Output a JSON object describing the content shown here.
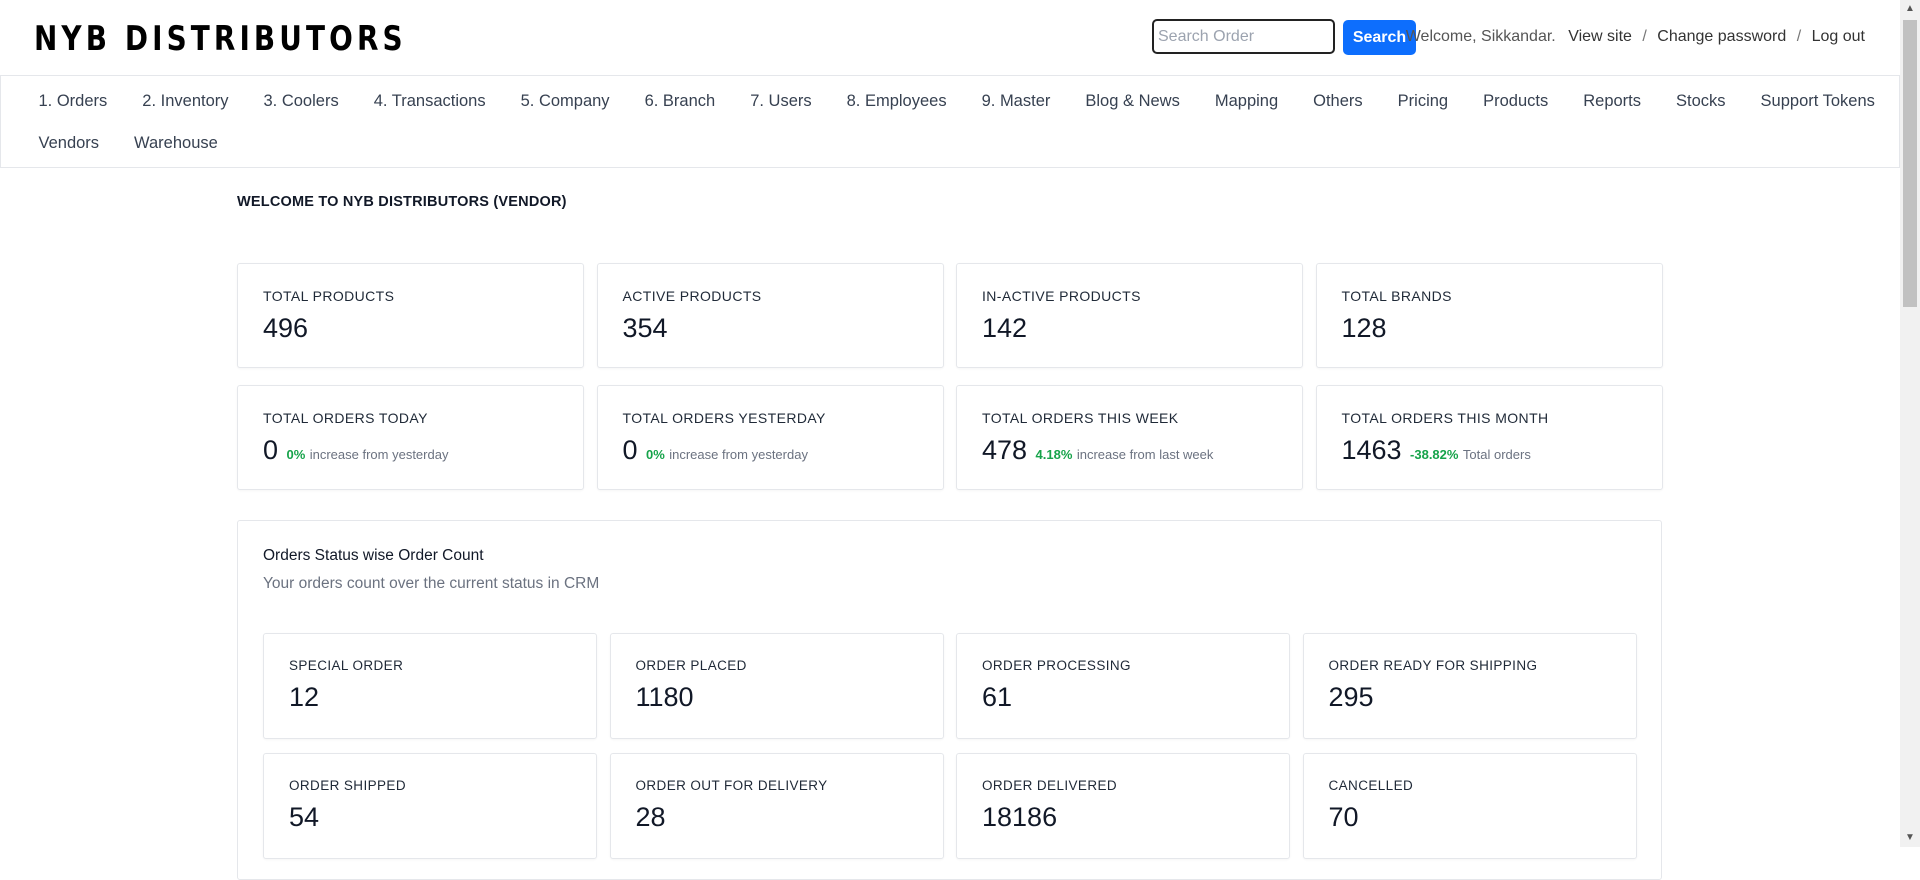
{
  "header": {
    "logo": "NYB DISTRIBUTORS",
    "search_placeholder": "Search Order",
    "search_button": "Search",
    "welcome_text": "Welcome, Sikkandar.",
    "view_site": "View site",
    "change_password": "Change password",
    "log_out": "Log out",
    "separator": "/"
  },
  "nav": {
    "items": [
      {
        "label": "1. Orders"
      },
      {
        "label": "2. Inventory"
      },
      {
        "label": "3. Coolers"
      },
      {
        "label": "4. Transactions"
      },
      {
        "label": "5. Company"
      },
      {
        "label": "6. Branch"
      },
      {
        "label": "7. Users"
      },
      {
        "label": "8. Employees"
      },
      {
        "label": "9. Master"
      },
      {
        "label": "Blog & News"
      },
      {
        "label": "Mapping"
      },
      {
        "label": "Others"
      },
      {
        "label": "Pricing"
      },
      {
        "label": "Products"
      },
      {
        "label": "Reports"
      },
      {
        "label": "Stocks"
      },
      {
        "label": "Support Tokens"
      },
      {
        "label": "Vendors"
      },
      {
        "label": "Warehouse"
      }
    ]
  },
  "main": {
    "welcome_title": "WELCOME TO NYB DISTRIBUTORS (VENDOR)",
    "product_stats": [
      {
        "label": "TOTAL PRODUCTS",
        "value": "496"
      },
      {
        "label": "ACTIVE PRODUCTS",
        "value": "354"
      },
      {
        "label": "IN-ACTIVE PRODUCTS",
        "value": "142"
      },
      {
        "label": "TOTAL BRANDS",
        "value": "128"
      }
    ],
    "order_stats": [
      {
        "label": "TOTAL ORDERS TODAY",
        "value": "0",
        "change": "0%",
        "note": "increase from yesterday"
      },
      {
        "label": "TOTAL ORDERS YESTERDAY",
        "value": "0",
        "change": "0%",
        "note": "increase from yesterday"
      },
      {
        "label": "TOTAL ORDERS THIS WEEK",
        "value": "478",
        "change": "4.18%",
        "note": "increase from last week"
      },
      {
        "label": "TOTAL ORDERS THIS MONTH",
        "value": "1463",
        "change": "-38.82%",
        "note": "Total orders"
      }
    ],
    "status_panel": {
      "title": "Orders Status wise Order Count",
      "subtitle": "Your orders count over the current status in CRM",
      "items": [
        {
          "label": "SPECIAL ORDER",
          "value": "12"
        },
        {
          "label": "ORDER PLACED",
          "value": "1180"
        },
        {
          "label": "ORDER PROCESSING",
          "value": "61"
        },
        {
          "label": "ORDER READY FOR SHIPPING",
          "value": "295"
        },
        {
          "label": "ORDER SHIPPED",
          "value": "54"
        },
        {
          "label": "ORDER OUT FOR DELIVERY",
          "value": "28"
        },
        {
          "label": "ORDER DELIVERED",
          "value": "18186"
        },
        {
          "label": "CANCELLED",
          "value": "70"
        }
      ]
    }
  },
  "colors": {
    "accent": "#0d6efd",
    "positive": "#16a34a"
  }
}
